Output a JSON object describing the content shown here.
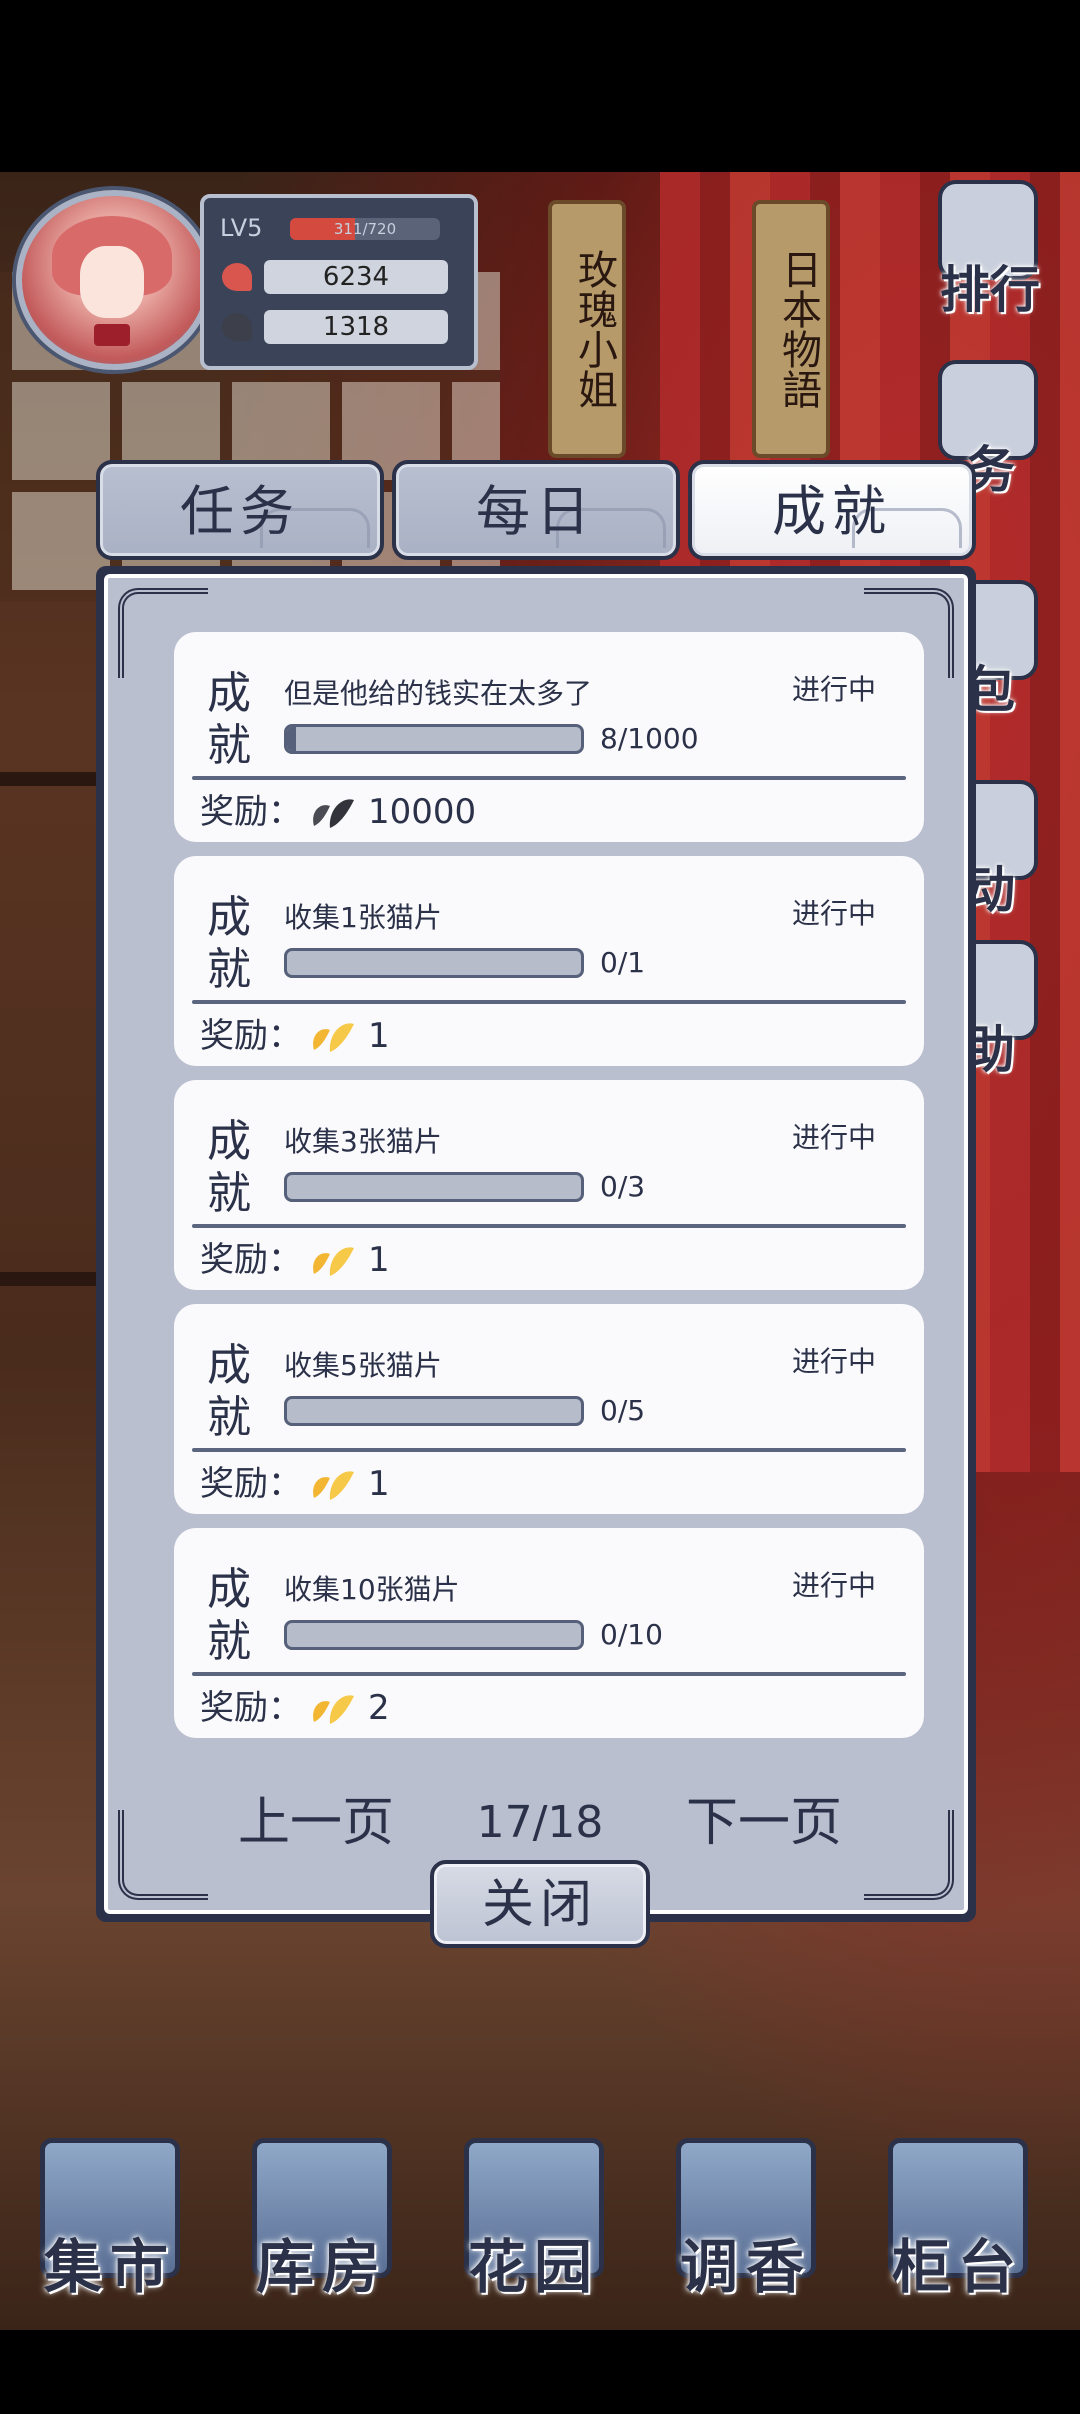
{
  "profile": {
    "level": "LV5",
    "xp_text": "311/720",
    "xp_progress": 0.43,
    "currency_red": "6234",
    "currency_grey": "1318"
  },
  "scene_tags": [
    "玫瑰小姐",
    "日本物語"
  ],
  "side_menu": [
    {
      "label": "排行",
      "icon": "ranking-icon"
    },
    {
      "label": "务",
      "icon": "task-icon"
    },
    {
      "label": "包",
      "icon": "bag-icon"
    },
    {
      "label": "动",
      "icon": "event-icon"
    },
    {
      "label": "助",
      "icon": "help-icon"
    }
  ],
  "tabs": [
    {
      "label": "任务",
      "active": false
    },
    {
      "label": "每日",
      "active": false
    },
    {
      "label": "成就",
      "active": true
    }
  ],
  "achievements": [
    {
      "kind": "成就",
      "title": "但是他给的钱实在太多了",
      "status": "进行中",
      "progress_text": "8/1000",
      "progress": 0.008,
      "reward_label": "奖励：",
      "reward_icon": "grey-petal-icon",
      "reward_value": "10000"
    },
    {
      "kind": "成就",
      "title": "收集1张猫片",
      "status": "进行中",
      "progress_text": "0/1",
      "progress": 0,
      "reward_label": "奖励：",
      "reward_icon": "gold-petal-icon",
      "reward_value": "1"
    },
    {
      "kind": "成就",
      "title": "收集3张猫片",
      "status": "进行中",
      "progress_text": "0/3",
      "progress": 0,
      "reward_label": "奖励：",
      "reward_icon": "gold-petal-icon",
      "reward_value": "1"
    },
    {
      "kind": "成就",
      "title": "收集5张猫片",
      "status": "进行中",
      "progress_text": "0/5",
      "progress": 0,
      "reward_label": "奖励：",
      "reward_icon": "gold-petal-icon",
      "reward_value": "1"
    },
    {
      "kind": "成就",
      "title": "收集10张猫片",
      "status": "进行中",
      "progress_text": "0/10",
      "progress": 0,
      "reward_label": "奖励：",
      "reward_icon": "gold-petal-icon",
      "reward_value": "2"
    }
  ],
  "pager": {
    "prev_label": "上一页",
    "page": "17/18",
    "next_label": "下一页"
  },
  "close_label": "关闭",
  "bottom_nav": [
    {
      "label": "集市",
      "icon": "market-icon"
    },
    {
      "label": "库房",
      "icon": "warehouse-icon"
    },
    {
      "label": "花园",
      "icon": "garden-icon"
    },
    {
      "label": "调香",
      "icon": "perfume-icon"
    },
    {
      "label": "柜台",
      "icon": "counter-icon"
    }
  ],
  "colors": {
    "ink": "#2b3148",
    "panel": "#b9bfcf",
    "card": "#fafafc",
    "xp": "#d54a3e",
    "gold": "#f2b632",
    "grey_petal": "#4a4a52"
  }
}
